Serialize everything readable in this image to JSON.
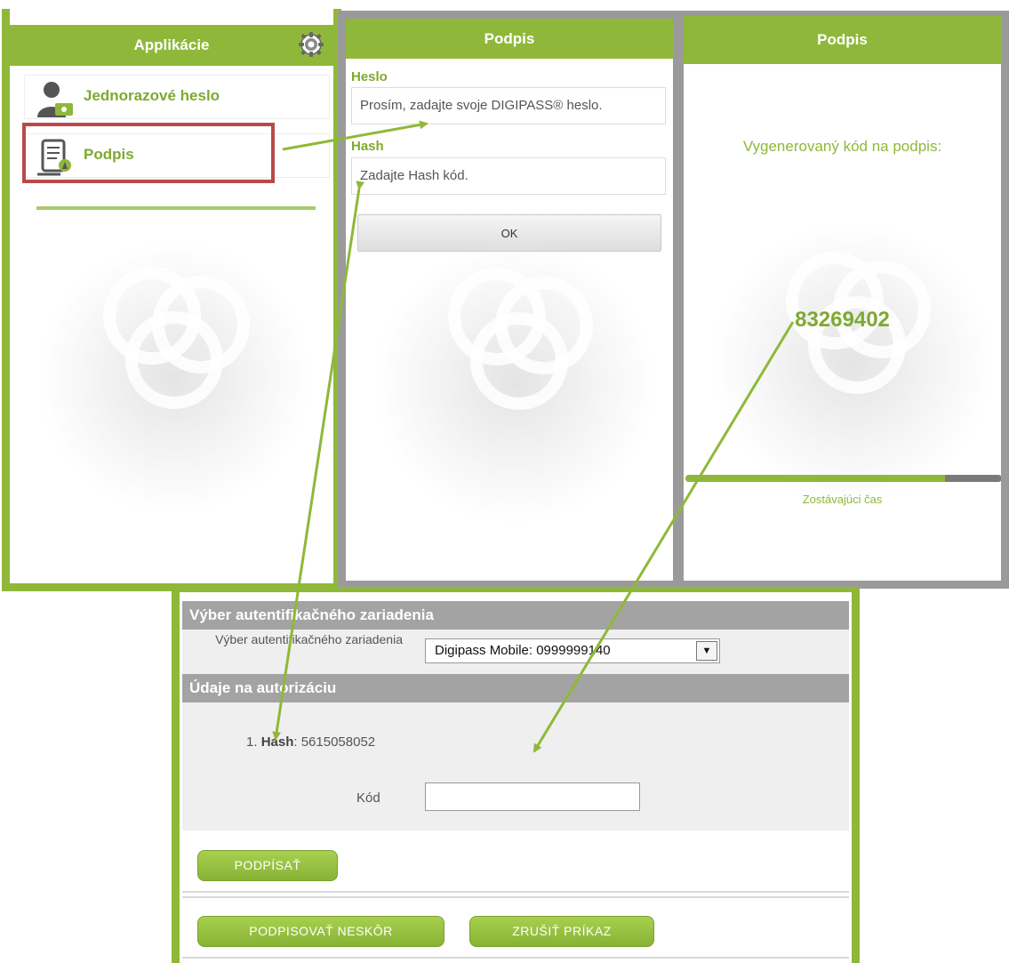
{
  "colors": {
    "accent": "#8fb83a",
    "highlight": "#b94a4a",
    "frame_gray": "#9a9a9a",
    "section_gray": "#a3a3a3"
  },
  "apps_panel": {
    "title": "Applikácie",
    "settings_icon": "gear-icon",
    "items": [
      {
        "label": "Jednorazové heslo",
        "icon": "user-key-icon"
      },
      {
        "label": "Podpis",
        "icon": "signature-document-icon"
      }
    ]
  },
  "sign_panel": {
    "title": "Podpis",
    "password_label": "Heslo",
    "password_placeholder": "Prosím, zadajte svoje DIGIPASS® heslo.",
    "hash_label": "Hash",
    "hash_placeholder": "Zadajte Hash kód.",
    "ok_label": "OK"
  },
  "result_panel": {
    "title": "Podpis",
    "caption": "Vygenerovaný kód na podpis:",
    "code": "83269402",
    "time_label": "Zostávajúci čas",
    "time_remaining": 0.82
  },
  "web_form": {
    "device_section_title": "Výber autentifikačného zariadenia",
    "device_label": "Výber autentifikačného zariadenia",
    "device_value": "Digipass Mobile: 0999999140",
    "auth_section_title": "Údaje na autorizáciu",
    "hash_index": "1.",
    "hash_key": "Hash",
    "hash_value": ": 5615058052",
    "code_label": "Kód",
    "code_value": "",
    "sign_button": "PODPÍSAŤ",
    "later_button": "PODPISOVAŤ NESKÔR",
    "cancel_button": "ZRUŠIŤ PRÍKAZ"
  }
}
